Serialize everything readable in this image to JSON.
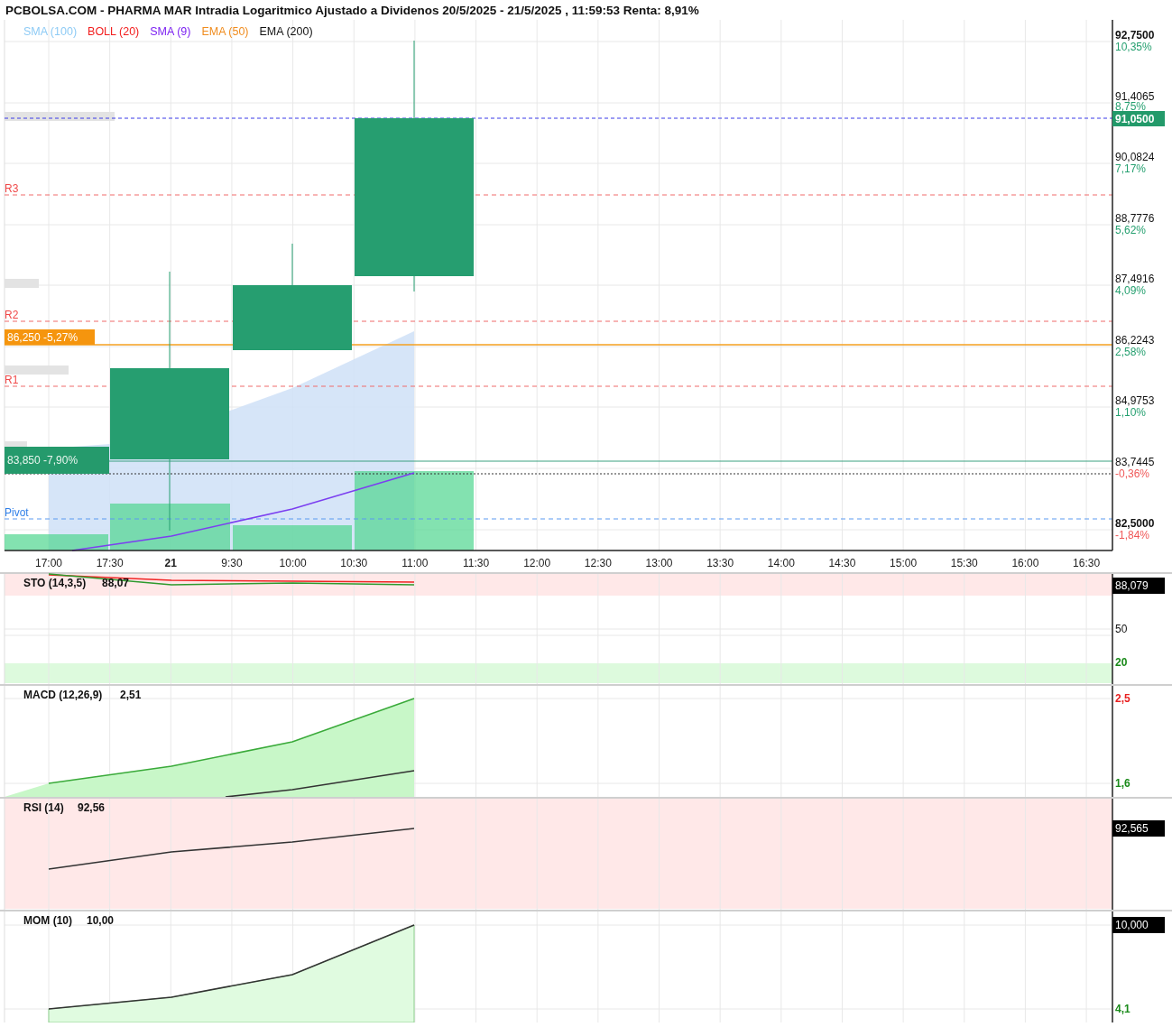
{
  "title": "PCBOLSA.COM - PHARMA MAR Intradia Logaritmico Ajustado a Dividenos 20/5/2025 - 21/5/2025 , 11:59:53 Renta: 8,91%",
  "legend": [
    {
      "label": "SMA (100)",
      "color": "#8ecbf5"
    },
    {
      "label": "BOLL (20)",
      "color": "#f21d1d"
    },
    {
      "label": "SMA (9)",
      "color": "#7b1ff2"
    },
    {
      "label": "EMA (50)",
      "color": "#f08c1e"
    },
    {
      "label": "EMA (200)",
      "color": "#111111"
    }
  ],
  "price_chart": {
    "current_price": "91,0500",
    "price_labels": [
      {
        "text": "92,7500",
        "bold": true
      },
      {
        "text": "91,4065",
        "bold": false
      },
      {
        "text": "90,0824",
        "bold": false
      },
      {
        "text": "88,7776",
        "bold": false
      },
      {
        "text": "87,4916",
        "bold": false
      },
      {
        "text": "86,2243",
        "bold": false
      },
      {
        "text": "84,9753",
        "bold": false
      },
      {
        "text": "83,7445",
        "bold": false
      },
      {
        "text": "82,5000",
        "bold": true
      }
    ],
    "percent_labels": [
      {
        "text": "10,35%",
        "kind": "gain"
      },
      {
        "text": "8,75%",
        "kind": "gain"
      },
      {
        "text": "7,17%",
        "kind": "gain"
      },
      {
        "text": "5,62%",
        "kind": "gain"
      },
      {
        "text": "4,09%",
        "kind": "gain"
      },
      {
        "text": "2,58%",
        "kind": "gain"
      },
      {
        "text": "1,10%",
        "kind": "gain"
      },
      {
        "text": "-0,36%",
        "kind": "loss"
      },
      {
        "text": "-1,84%",
        "kind": "loss"
      }
    ],
    "time_labels": [
      {
        "text": "17:00",
        "bold": false
      },
      {
        "text": "17:30",
        "bold": false
      },
      {
        "text": "21",
        "bold": true
      },
      {
        "text": "9:30",
        "bold": false
      },
      {
        "text": "10:00",
        "bold": false
      },
      {
        "text": "10:30",
        "bold": false
      },
      {
        "text": "11:00",
        "bold": false
      },
      {
        "text": "11:30",
        "bold": false
      },
      {
        "text": "12:00",
        "bold": false
      },
      {
        "text": "12:30",
        "bold": false
      },
      {
        "text": "13:00",
        "bold": false
      },
      {
        "text": "13:30",
        "bold": false
      },
      {
        "text": "14:00",
        "bold": false
      },
      {
        "text": "14:30",
        "bold": false
      },
      {
        "text": "15:00",
        "bold": false
      },
      {
        "text": "15:30",
        "bold": false
      },
      {
        "text": "16:00",
        "bold": false
      },
      {
        "text": "16:30",
        "bold": false
      }
    ],
    "levels": [
      {
        "kind": "resistance",
        "label": "R3"
      },
      {
        "kind": "resistance",
        "label": "R2"
      },
      {
        "kind": "resistance",
        "label": "R1"
      },
      {
        "kind": "pivot",
        "label": "Pivot"
      }
    ],
    "price_tags": [
      {
        "kind": "orange",
        "text": "86,250  -5,27%"
      },
      {
        "kind": "green",
        "text": "83,850  -7,90%"
      }
    ]
  },
  "sto": {
    "title": "STO (14,3,5)",
    "value": "88,07",
    "value_label": "88,079",
    "axis_labels": [
      {
        "text": "50",
        "kind": "neutral"
      },
      {
        "text": "20",
        "kind": "low"
      }
    ]
  },
  "macd": {
    "title": "MACD (12,26,9)",
    "value": "2,51",
    "axis_labels": [
      {
        "text": "2,5",
        "kind": "high"
      },
      {
        "text": "1,6",
        "kind": "low"
      }
    ]
  },
  "rsi": {
    "title": "RSI (14)",
    "value": "92,56",
    "value_label": "92,565"
  },
  "mom": {
    "title": "MOM (10)",
    "value": "10,00",
    "value_label": "10,000",
    "axis_labels": [
      {
        "text": "4,1",
        "kind": "low"
      }
    ]
  }
}
